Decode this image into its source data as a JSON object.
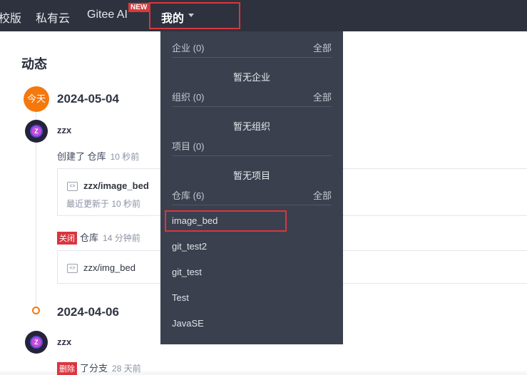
{
  "nav": {
    "items": [
      "校版",
      "私有云",
      "Gitee AI"
    ],
    "new_badge": "NEW",
    "mine_label": "我的"
  },
  "feed": {
    "title": "动态",
    "today_badge": "今天",
    "groups": [
      {
        "date": "2024-05-04",
        "user": "zzx",
        "events": [
          {
            "action": "创建了 仓库",
            "time": "10 秒前",
            "card_title": "zzx/image_bed",
            "card_sub": "最近更新于 10 秒前"
          },
          {
            "tag": "关闭",
            "action": "仓库",
            "time": "14 分钟前",
            "card_title": "zzx/img_bed"
          }
        ]
      },
      {
        "date": "2024-04-06",
        "user": "zzx",
        "events": [
          {
            "tag": "删除",
            "action": "了分支",
            "time": "28 天前"
          }
        ]
      }
    ]
  },
  "dropdown": {
    "sections": [
      {
        "label": "企业 (0)",
        "all": "全部",
        "empty": "暂无企业"
      },
      {
        "label": "组织 (0)",
        "all": "全部",
        "empty": "暂无组织"
      },
      {
        "label": "项目 (0)",
        "empty": "暂无项目"
      },
      {
        "label": "仓库 (6)",
        "all": "全部"
      }
    ],
    "repos": [
      "image_bed",
      "git_test2",
      "git_test",
      "Test",
      "JavaSE"
    ]
  },
  "avatar_letter": "Z",
  "colors": {
    "accent": "#f5780e",
    "danger": "#d9363e",
    "nav_bg": "#2e323e",
    "dropdown_bg": "#3a404e"
  }
}
